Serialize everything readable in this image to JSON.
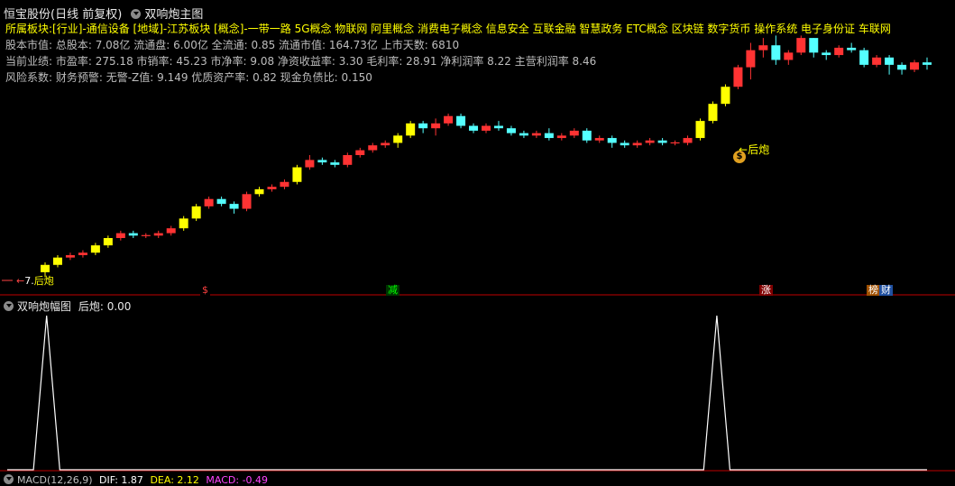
{
  "window": {
    "stock_title": "恒宝股份(日线 前复权)",
    "main_panel_title": "双响炮主图"
  },
  "info": {
    "sectors_label": "所属板块:",
    "sectors_text": "[行业]-通信设备 [地域]-江苏板块 [概念]-一带一路 5G概念 物联网 阿里概念 消费电子概念 信息安全 互联金融 智慧政务 ETC概念 区块链 数字货币 操作系统 电子身份证 车联网",
    "line1": "股本市值: 总股本: 7.08亿 流通盘: 6.00亿 全流通: 0.85 流通市值: 164.73亿 上市天数: 6810",
    "line2": "当前业绩: 市盈率: 275.18 市销率: 45.23 市净率: 9.08 净资收益率: 3.30 毛利率: 28.91 净利润率 8.22 主营利润率 8.46",
    "line3": "风险系数: 财务预警: 无警-Z值: 9.149 优质资产率: 0.82 现金负债比: 0.150"
  },
  "annotations": {
    "left_signal": "7.",
    "left_label": "后炮",
    "right_label": "后炮",
    "money_icon": "$"
  },
  "markers": [
    {
      "text": "$",
      "color": "#ff4040",
      "bg": "#000000"
    },
    {
      "text": "减",
      "color": "#00ff00",
      "bg": "#003300"
    },
    {
      "text": "涨",
      "color": "#ffffff",
      "bg": "#800000"
    },
    {
      "text": "榜",
      "color": "#ffffff",
      "bg": "#a05000"
    },
    {
      "text": "财",
      "color": "#ffffff",
      "bg": "#2050a0"
    }
  ],
  "sub_panel": {
    "title": "双响炮幅图",
    "indicator": "后炮: 0.00"
  },
  "macd": {
    "label": "MACD(12,26,9)",
    "dif": "DIF: 1.87",
    "dea": "DEA: 2.12",
    "macd": "MACD: -0.49"
  },
  "colors": {
    "up": "#ff3333",
    "down": "#54ffff",
    "highlight": "#ffff00",
    "signal_line": "#ffffff",
    "separator": "#c00000"
  },
  "chart_data": {
    "type": "candlestick",
    "candles": [
      [
        7.5,
        7.8,
        7.3,
        7.9
      ],
      [
        7.8,
        8.1,
        7.7,
        8.2
      ],
      [
        8.1,
        8.2,
        8.0,
        8.3
      ],
      [
        8.2,
        8.3,
        8.1,
        8.4
      ],
      [
        8.3,
        8.6,
        8.2,
        8.7
      ],
      [
        8.6,
        8.9,
        8.5,
        9.0
      ],
      [
        8.9,
        9.1,
        8.8,
        9.2
      ],
      [
        9.1,
        9.0,
        8.9,
        9.2
      ],
      [
        9.0,
        9.0,
        8.9,
        9.1
      ],
      [
        9.0,
        9.1,
        8.9,
        9.2
      ],
      [
        9.1,
        9.3,
        9.0,
        9.4
      ],
      [
        9.3,
        9.7,
        9.2,
        9.8
      ],
      [
        9.7,
        10.2,
        9.6,
        10.3
      ],
      [
        10.2,
        10.5,
        10.1,
        10.6
      ],
      [
        10.5,
        10.3,
        10.2,
        10.6
      ],
      [
        10.3,
        10.1,
        9.9,
        10.4
      ],
      [
        10.1,
        10.7,
        10.0,
        10.8
      ],
      [
        10.7,
        10.9,
        10.6,
        11.0
      ],
      [
        10.9,
        11.0,
        10.8,
        11.1
      ],
      [
        11.0,
        11.2,
        10.9,
        11.3
      ],
      [
        11.2,
        11.8,
        11.1,
        11.9
      ],
      [
        11.8,
        12.1,
        11.7,
        12.3
      ],
      [
        12.1,
        12.0,
        11.9,
        12.2
      ],
      [
        12.0,
        11.9,
        11.8,
        12.1
      ],
      [
        11.9,
        12.3,
        11.8,
        12.4
      ],
      [
        12.3,
        12.5,
        12.2,
        12.6
      ],
      [
        12.5,
        12.7,
        12.4,
        12.8
      ],
      [
        12.7,
        12.8,
        12.6,
        12.9
      ],
      [
        12.8,
        13.1,
        12.6,
        13.2
      ],
      [
        13.1,
        13.6,
        13.0,
        13.7
      ],
      [
        13.6,
        13.4,
        13.2,
        13.7
      ],
      [
        13.4,
        13.6,
        13.1,
        13.8
      ],
      [
        13.6,
        13.9,
        13.5,
        14.0
      ],
      [
        13.9,
        13.5,
        13.4,
        14.0
      ],
      [
        13.5,
        13.3,
        13.2,
        13.6
      ],
      [
        13.3,
        13.5,
        13.2,
        13.6
      ],
      [
        13.5,
        13.4,
        13.3,
        13.7
      ],
      [
        13.4,
        13.2,
        13.1,
        13.5
      ],
      [
        13.2,
        13.1,
        13.0,
        13.3
      ],
      [
        13.1,
        13.2,
        13.0,
        13.3
      ],
      [
        13.2,
        13.0,
        12.9,
        13.4
      ],
      [
        13.0,
        13.1,
        12.9,
        13.2
      ],
      [
        13.1,
        13.3,
        13.0,
        13.4
      ],
      [
        13.3,
        12.9,
        12.8,
        13.4
      ],
      [
        12.9,
        13.0,
        12.8,
        13.1
      ],
      [
        13.0,
        12.8,
        12.6,
        13.1
      ],
      [
        12.8,
        12.7,
        12.6,
        12.9
      ],
      [
        12.7,
        12.8,
        12.6,
        12.9
      ],
      [
        12.8,
        12.9,
        12.7,
        13.0
      ],
      [
        12.9,
        12.8,
        12.7,
        13.0
      ],
      [
        12.8,
        12.8,
        12.7,
        12.9
      ],
      [
        12.8,
        13.0,
        12.7,
        13.1
      ],
      [
        13.0,
        13.7,
        12.9,
        13.8
      ],
      [
        13.7,
        14.4,
        13.6,
        14.5
      ],
      [
        14.4,
        15.1,
        14.3,
        15.2
      ],
      [
        15.1,
        15.9,
        15.0,
        16.0
      ],
      [
        15.9,
        16.6,
        15.4,
        16.9
      ],
      [
        16.6,
        16.8,
        16.3,
        17.1
      ],
      [
        16.8,
        16.2,
        16.0,
        17.2
      ],
      [
        16.2,
        16.5,
        16.0,
        16.6
      ],
      [
        16.5,
        17.1,
        16.4,
        17.2
      ],
      [
        17.1,
        16.5,
        16.3,
        17.1
      ],
      [
        16.5,
        16.4,
        16.2,
        16.6
      ],
      [
        16.4,
        16.7,
        16.3,
        16.8
      ],
      [
        16.7,
        16.6,
        16.5,
        16.9
      ],
      [
        16.6,
        16.0,
        15.9,
        16.7
      ],
      [
        16.0,
        16.3,
        15.9,
        16.4
      ],
      [
        16.3,
        16.0,
        15.6,
        16.4
      ],
      [
        16.0,
        15.8,
        15.6,
        16.1
      ],
      [
        15.8,
        16.1,
        15.7,
        16.2
      ],
      [
        16.1,
        16.0,
        15.8,
        16.3
      ]
    ],
    "signal_series": [
      0,
      0,
      0,
      1,
      0,
      0,
      0,
      0,
      0,
      0,
      0,
      0,
      0,
      0,
      0,
      0,
      0,
      0,
      0,
      0,
      0,
      0,
      0,
      0,
      0,
      0,
      0,
      0,
      0,
      0,
      0,
      0,
      0,
      0,
      0,
      0,
      0,
      0,
      0,
      0,
      0,
      0,
      0,
      0,
      0,
      0,
      0,
      0,
      0,
      0,
      0,
      0,
      0,
      0,
      1,
      0,
      0,
      0,
      0,
      0,
      0,
      0,
      0,
      0,
      0,
      0,
      0,
      0,
      0,
      0,
      0
    ]
  }
}
